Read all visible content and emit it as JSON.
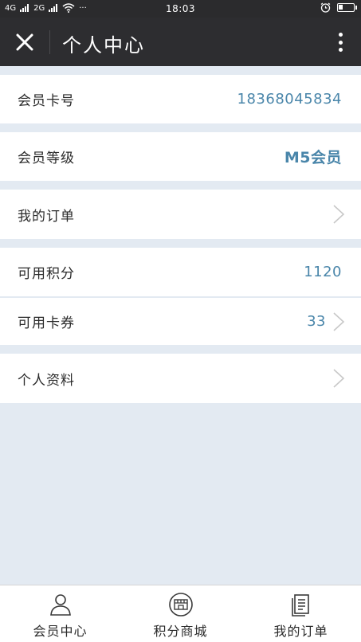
{
  "status_bar": {
    "signal_1": "4G",
    "signal_2": "2G",
    "more": "···",
    "time": "18:03"
  },
  "header": {
    "title": "个人中心"
  },
  "rows": [
    {
      "label": "会员卡号",
      "value": "18368045834"
    },
    {
      "label": "会员等级",
      "value": "M5会员"
    },
    {
      "label": "我的订单",
      "value": ""
    },
    {
      "label": "可用积分",
      "value": "1120"
    },
    {
      "label": "可用卡券",
      "value": "33"
    },
    {
      "label": "个人资料",
      "value": ""
    }
  ],
  "tabs": [
    {
      "label": "会员中心",
      "icon": "person-icon"
    },
    {
      "label": "积分商城",
      "icon": "store-icon"
    },
    {
      "label": "我的订单",
      "icon": "document-icon"
    }
  ],
  "colors": {
    "header_bg": "#2d2d30",
    "value_accent": "#4a86aa",
    "page_bg": "#e3eaf2"
  }
}
